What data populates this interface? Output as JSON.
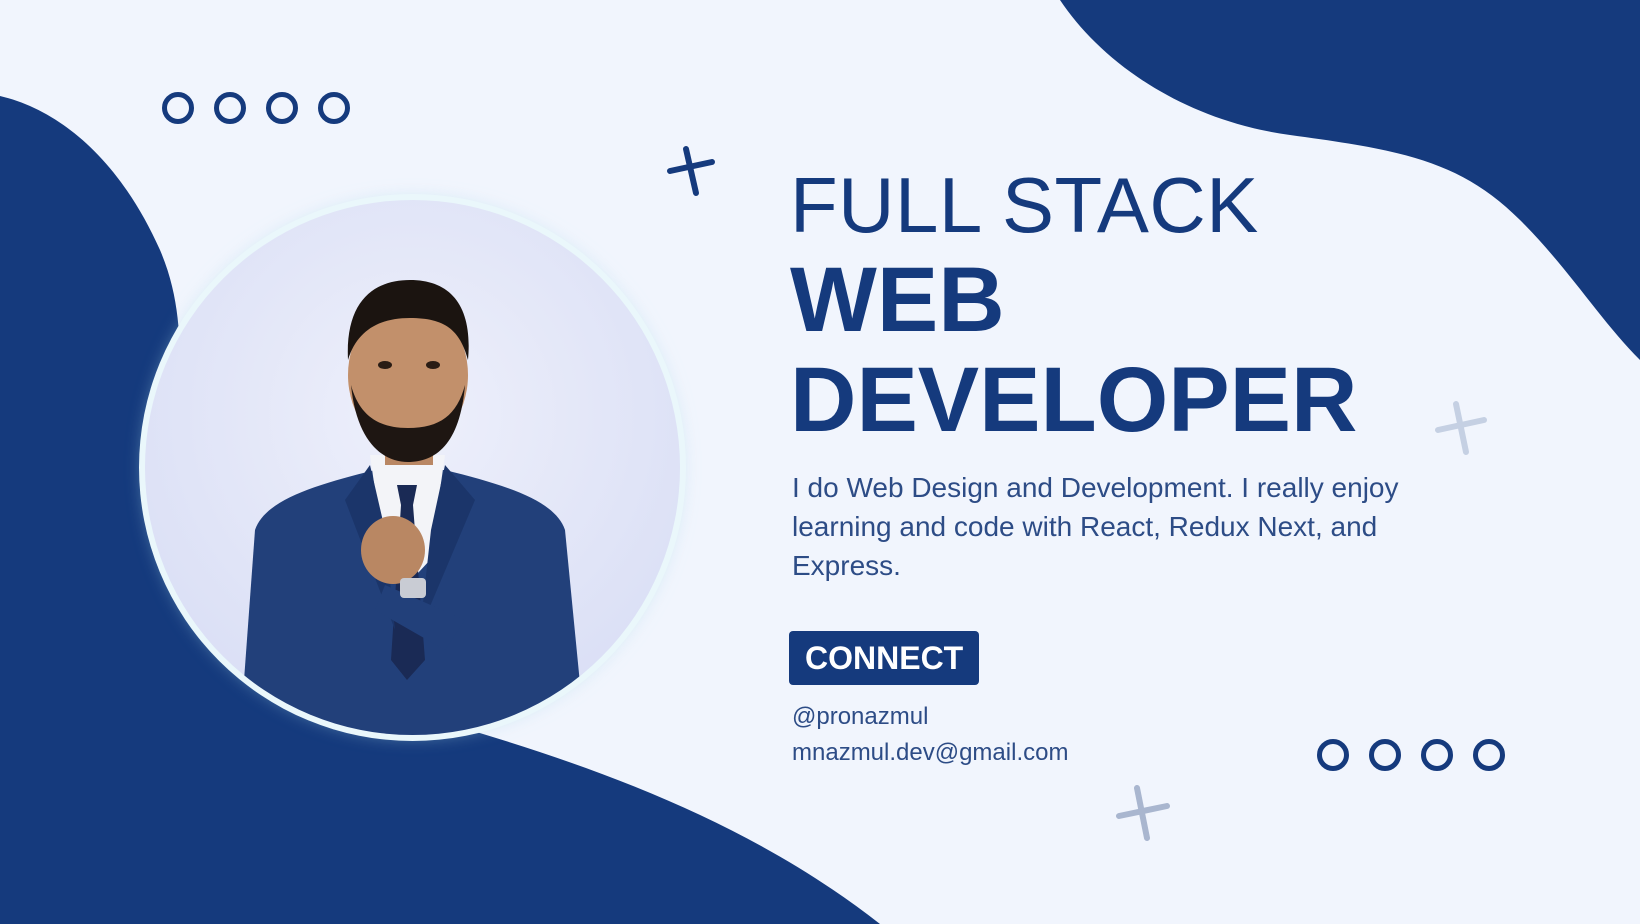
{
  "hero": {
    "title_line1": "FULL STACK",
    "title_line2": "WEB",
    "title_line3": "DEVELOPER",
    "description": "I do Web Design and Development. I really enjoy learning and code with React, Redux  Next, and Express.",
    "connect_label": "CONNECT"
  },
  "contact": {
    "handle": "@pronazmul",
    "email": "mnazmul.dev@gmail.com"
  },
  "colors": {
    "background": "#f1f5fd",
    "brand_blue": "#153a7d",
    "body_text": "#2d4c86",
    "plus_light": "#b7c3d9",
    "photo_ring": "#eaf7fb"
  },
  "icons": {
    "decor_top": "ring-dots-icon",
    "decor_bottom": "ring-dots-icon",
    "sparkles": "plus-icon"
  }
}
